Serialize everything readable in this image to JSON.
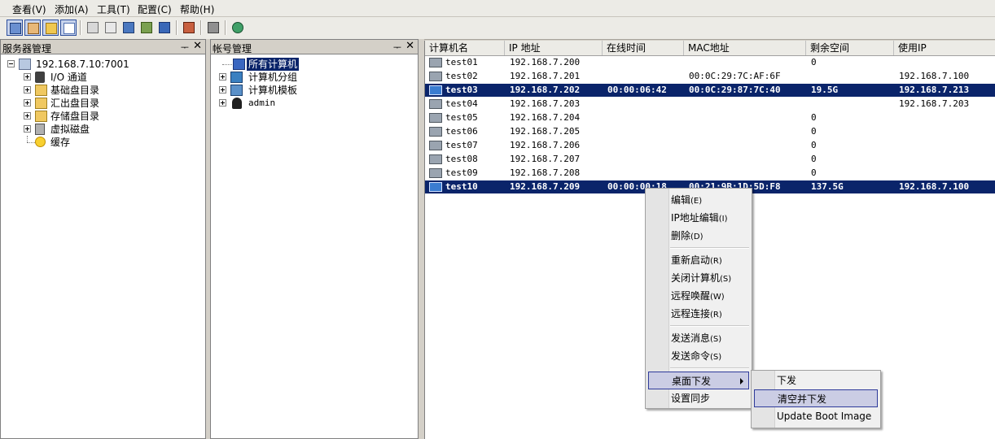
{
  "menubar": {
    "items": [
      "查看(V)",
      "添加(A)",
      "工具(T)",
      "配置(C)",
      "帮助(H)"
    ]
  },
  "server_panel": {
    "title": "服务器管理",
    "root": "192.168.7.10:7001",
    "children": [
      "I/O 通道",
      "基础盘目录",
      "汇出盘目录",
      "存储盘目录",
      "虚拟磁盘",
      "缓存"
    ]
  },
  "account_panel": {
    "title": "帐号管理",
    "items": [
      "所有计算机",
      "计算机分组",
      "计算机模板",
      "admin"
    ]
  },
  "computer_table": {
    "columns": [
      "计算机名",
      "IP 地址",
      "在线时间",
      "MAC地址",
      "剩余空间",
      "使用IP"
    ],
    "rows": [
      {
        "name": "test01",
        "ip": "192.168.7.200",
        "online": "",
        "mac": "",
        "free": "0",
        "use_ip": "",
        "selected": false
      },
      {
        "name": "test02",
        "ip": "192.168.7.201",
        "online": "",
        "mac": "00:0C:29:7C:AF:6F",
        "free": "",
        "use_ip": "192.168.7.100",
        "selected": false
      },
      {
        "name": "test03",
        "ip": "192.168.7.202",
        "online": "00:00:06:42",
        "mac": "00:0C:29:87:7C:40",
        "free": "19.5G",
        "use_ip": "192.168.7.213",
        "selected": true
      },
      {
        "name": "test04",
        "ip": "192.168.7.203",
        "online": "",
        "mac": "",
        "free": "",
        "use_ip": "192.168.7.203",
        "selected": false
      },
      {
        "name": "test05",
        "ip": "192.168.7.204",
        "online": "",
        "mac": "",
        "free": "0",
        "use_ip": "",
        "selected": false
      },
      {
        "name": "test06",
        "ip": "192.168.7.205",
        "online": "",
        "mac": "",
        "free": "0",
        "use_ip": "",
        "selected": false
      },
      {
        "name": "test07",
        "ip": "192.168.7.206",
        "online": "",
        "mac": "",
        "free": "0",
        "use_ip": "",
        "selected": false
      },
      {
        "name": "test08",
        "ip": "192.168.7.207",
        "online": "",
        "mac": "",
        "free": "0",
        "use_ip": "",
        "selected": false
      },
      {
        "name": "test09",
        "ip": "192.168.7.208",
        "online": "",
        "mac": "",
        "free": "0",
        "use_ip": "",
        "selected": false
      },
      {
        "name": "test10",
        "ip": "192.168.7.209",
        "online": "00:00:00:18",
        "mac": "00:21:9B:1D:5D:F8",
        "free": "137.5G",
        "use_ip": "192.168.7.100",
        "selected": true
      }
    ]
  },
  "context_menu": {
    "items": [
      "编辑",
      "IP地址编辑",
      "删除",
      "重新启动",
      "关闭计算机",
      "远程唤醒",
      "远程连接",
      "发送消息",
      "发送命令",
      "桌面下发",
      "设置同步"
    ],
    "mnemonics": [
      "(E)",
      "(I)",
      "(D)",
      "(R)",
      "(S)",
      "(W)",
      "(R)",
      "(S)",
      "(S)",
      "",
      ""
    ]
  },
  "submenu": {
    "items": [
      "下发",
      "清空并下发",
      "Update Boot Image"
    ]
  },
  "colors": {
    "selection": "#0a246a",
    "menu_highlight": "#cbcde4"
  }
}
